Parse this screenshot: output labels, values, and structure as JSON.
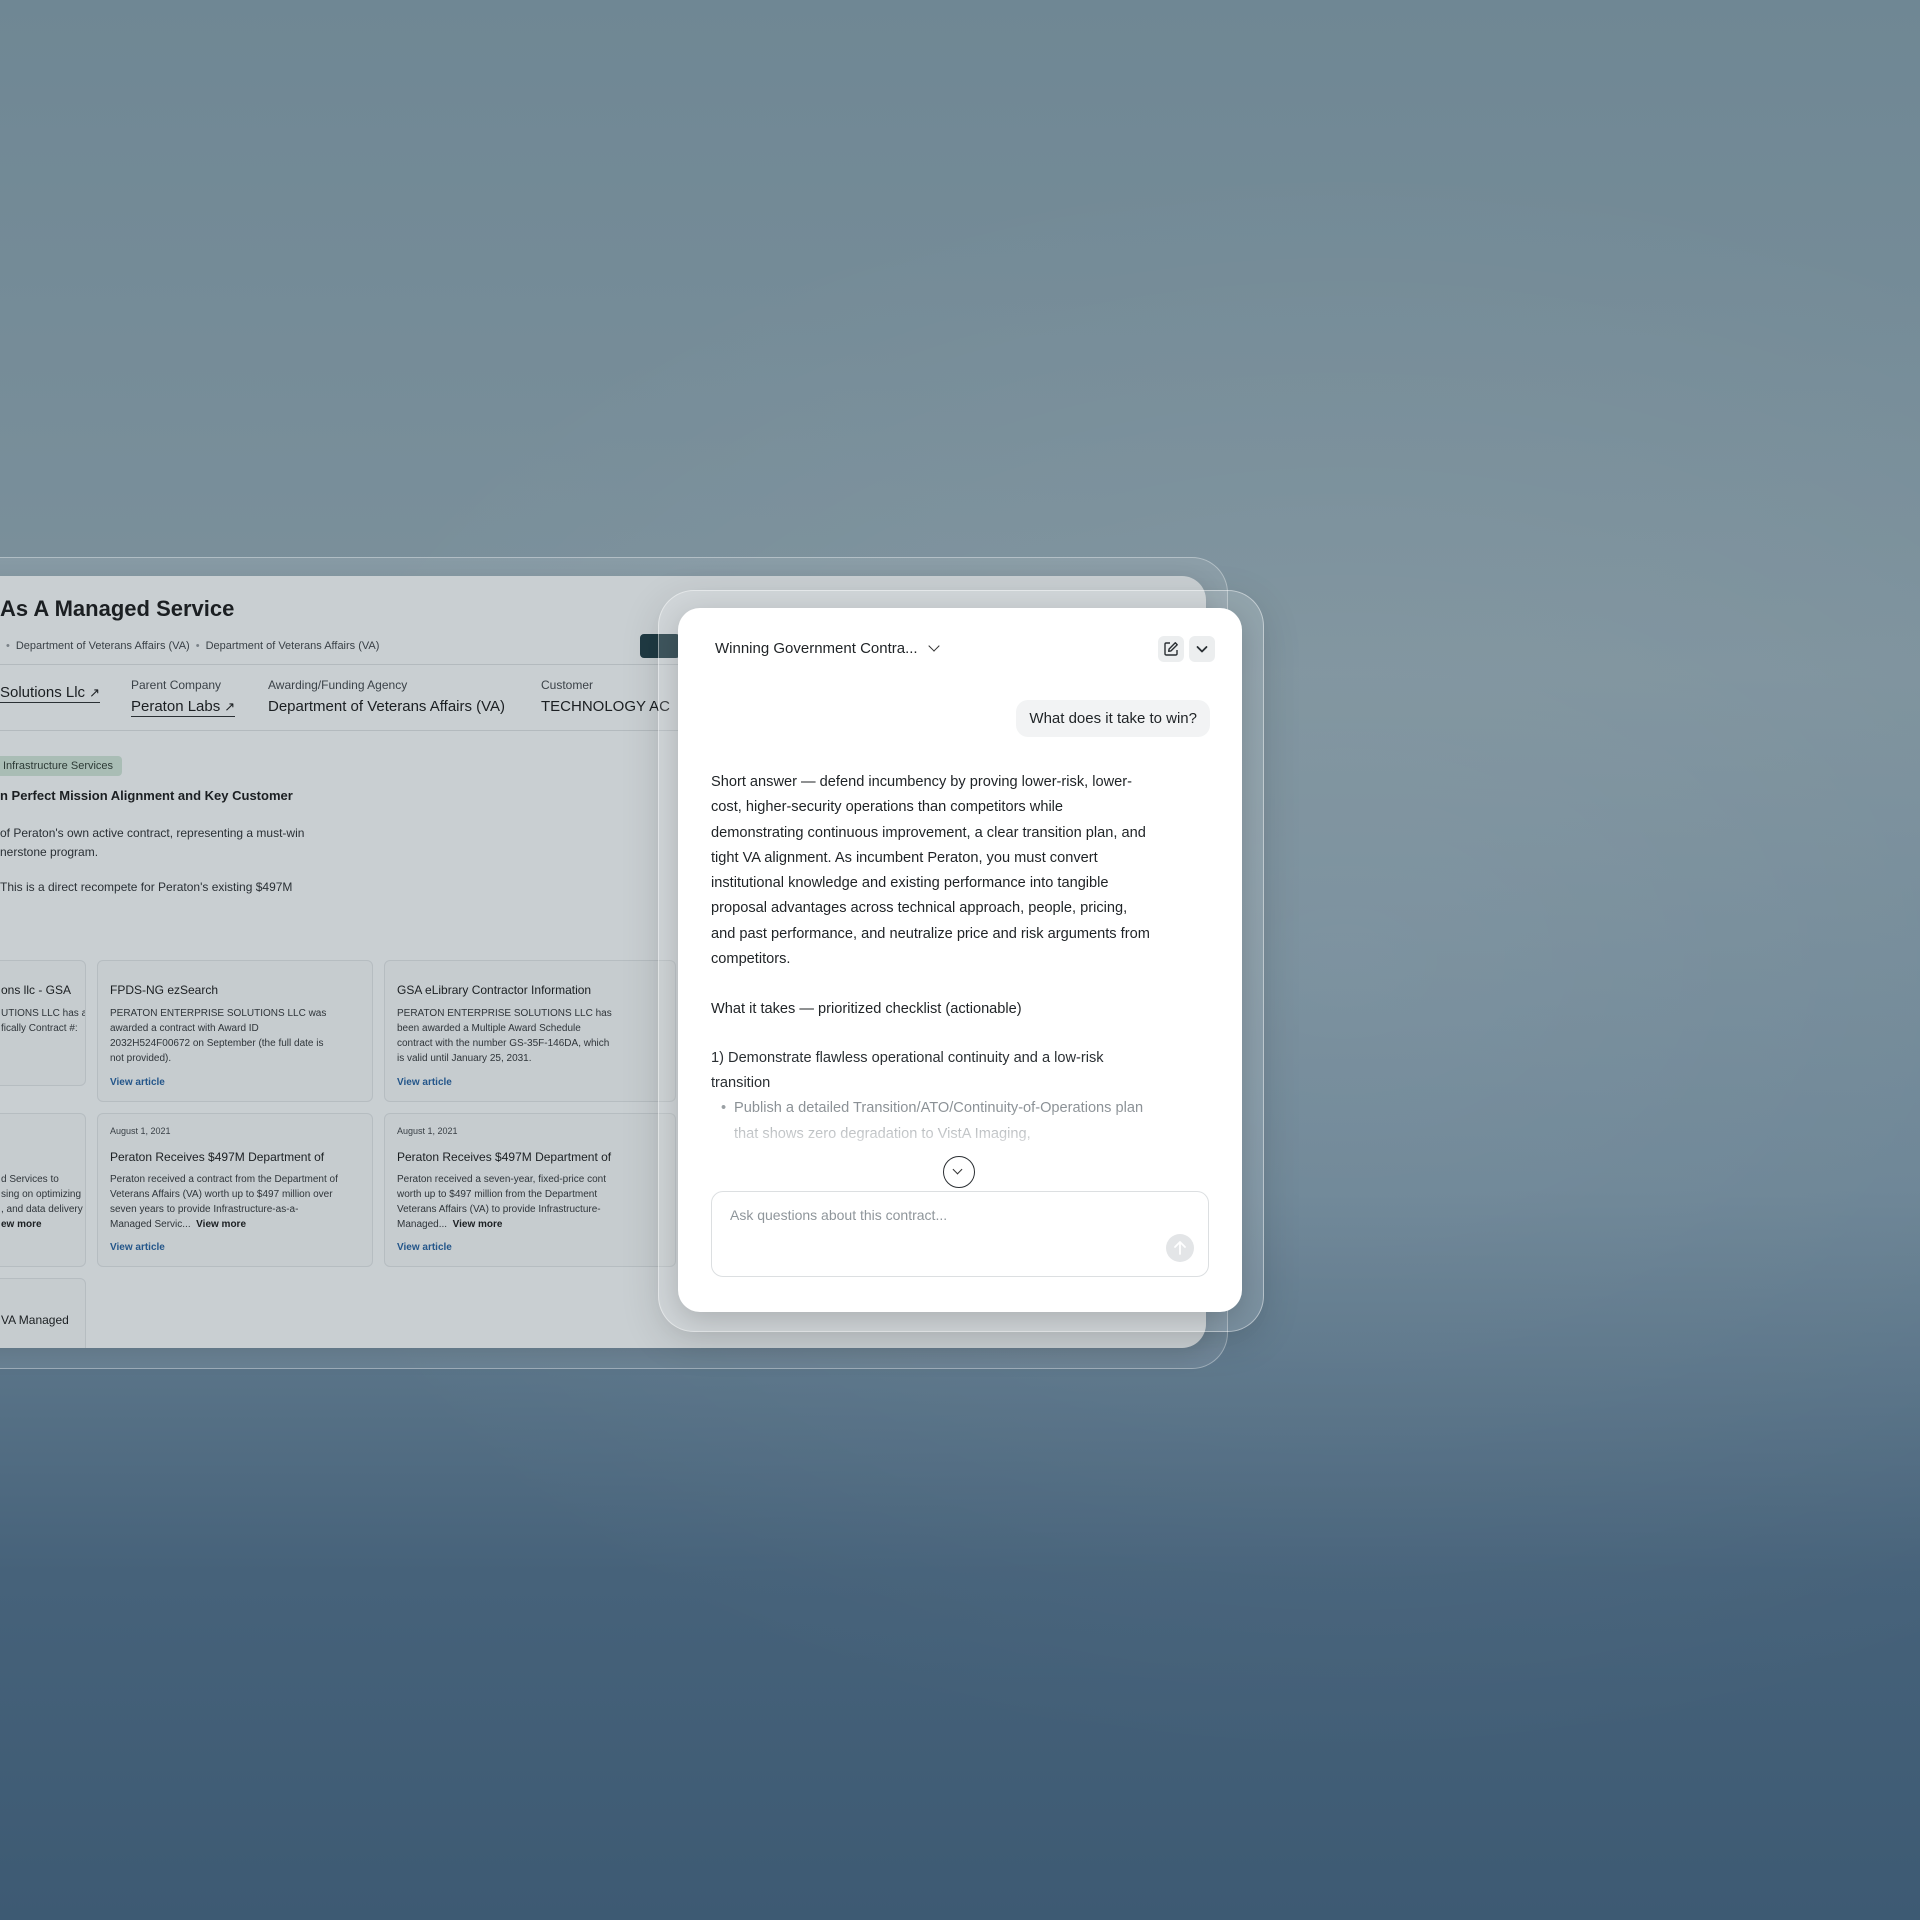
{
  "background": {
    "accent": "#6f8794"
  },
  "contract": {
    "title": "As A Managed Service",
    "breadcrumbs": [
      "Department of Veterans Affairs (VA)",
      "Department of Veterans Affairs (VA)"
    ],
    "meta": [
      {
        "label": "",
        "value": "Solutions Llc"
      },
      {
        "label": "Parent Company",
        "value": "Peraton Labs"
      },
      {
        "label": "Awarding/Funding Agency",
        "value": "Department of Veterans Affairs (VA)"
      },
      {
        "label": "Customer",
        "value": "TECHNOLOGY AC"
      }
    ],
    "tag": "Infrastructure Services",
    "subheading": "n Perfect Mission Alignment and Key Customer",
    "para1_line1": "of Peraton's own active contract, representing a must-win",
    "para1_line2": "nerstone program.",
    "para2": "This is a direct recompete for Peraton's existing $497M"
  },
  "sources": {
    "view_article": "View article",
    "view_more": "View more",
    "cards": [
      {
        "title": "ons llc - GSA",
        "lines": [
          "UTIONS LLC has a",
          "fically Contract #:"
        ]
      },
      {
        "title": "FPDS-NG ezSearch",
        "lines": [
          "PERATON ENTERPRISE SOLUTIONS LLC was",
          "awarded a contract with Award ID",
          "2032H524F00672 on September (the full date is",
          "not provided)."
        ]
      },
      {
        "title": "GSA eLibrary Contractor Information",
        "lines": [
          "PERATON ENTERPRISE SOLUTIONS LLC has",
          "been awarded a Multiple Award Schedule",
          "contract with the number GS-35F-146DA, which",
          "is valid until January 25, 2031."
        ]
      },
      {
        "lines": [
          "d Services to",
          "sing on optimizing",
          ", and data delivery for"
        ],
        "trunc": "ew more"
      },
      {
        "date": "August 1, 2021",
        "title": "Peraton Receives $497M Department of",
        "lines": [
          "Peraton received a contract from the Department of",
          "Veterans Affairs (VA) worth up to $497 million over",
          "seven years to provide Infrastructure-as-a-"
        ],
        "trunc": "Managed Servic..."
      },
      {
        "date": "August 1, 2021",
        "title": "Peraton Receives $497M Department of",
        "lines": [
          "Peraton received a seven-year, fixed-price cont",
          "worth up to $497 million from the Department",
          "Veterans Affairs (VA) to provide Infrastructure-"
        ],
        "trunc": "Managed..."
      },
      {
        "title": "VA Managed"
      }
    ]
  },
  "chat": {
    "title": "Winning Government Contra...",
    "user_message": "What does it take to win?",
    "answer_intro": "Short answer — defend incumbency by proving lower-risk, lower-cost, higher-security operations than competitors while demonstrating continuous improvement, a clear transition plan, and tight VA alignment. As incumbent Peraton, you must convert institutional knowledge and existing performance into tangible proposal advantages across technical approach, people, pricing, and past performance, and neutralize price and risk arguments from competitors.",
    "checklist_heading": "What it takes — prioritized checklist (actionable)",
    "point1": "1) Demonstrate flawless operational continuity and a low-risk transition",
    "bullet1": "Publish a detailed Transition/ATO/Continuity-of-Operations plan that shows zero degradation to VistA Imaging,",
    "input_placeholder": "Ask questions about this contract...",
    "icons": [
      "compose-icon",
      "chevron-down-icon",
      "send-arrow-icon"
    ]
  }
}
